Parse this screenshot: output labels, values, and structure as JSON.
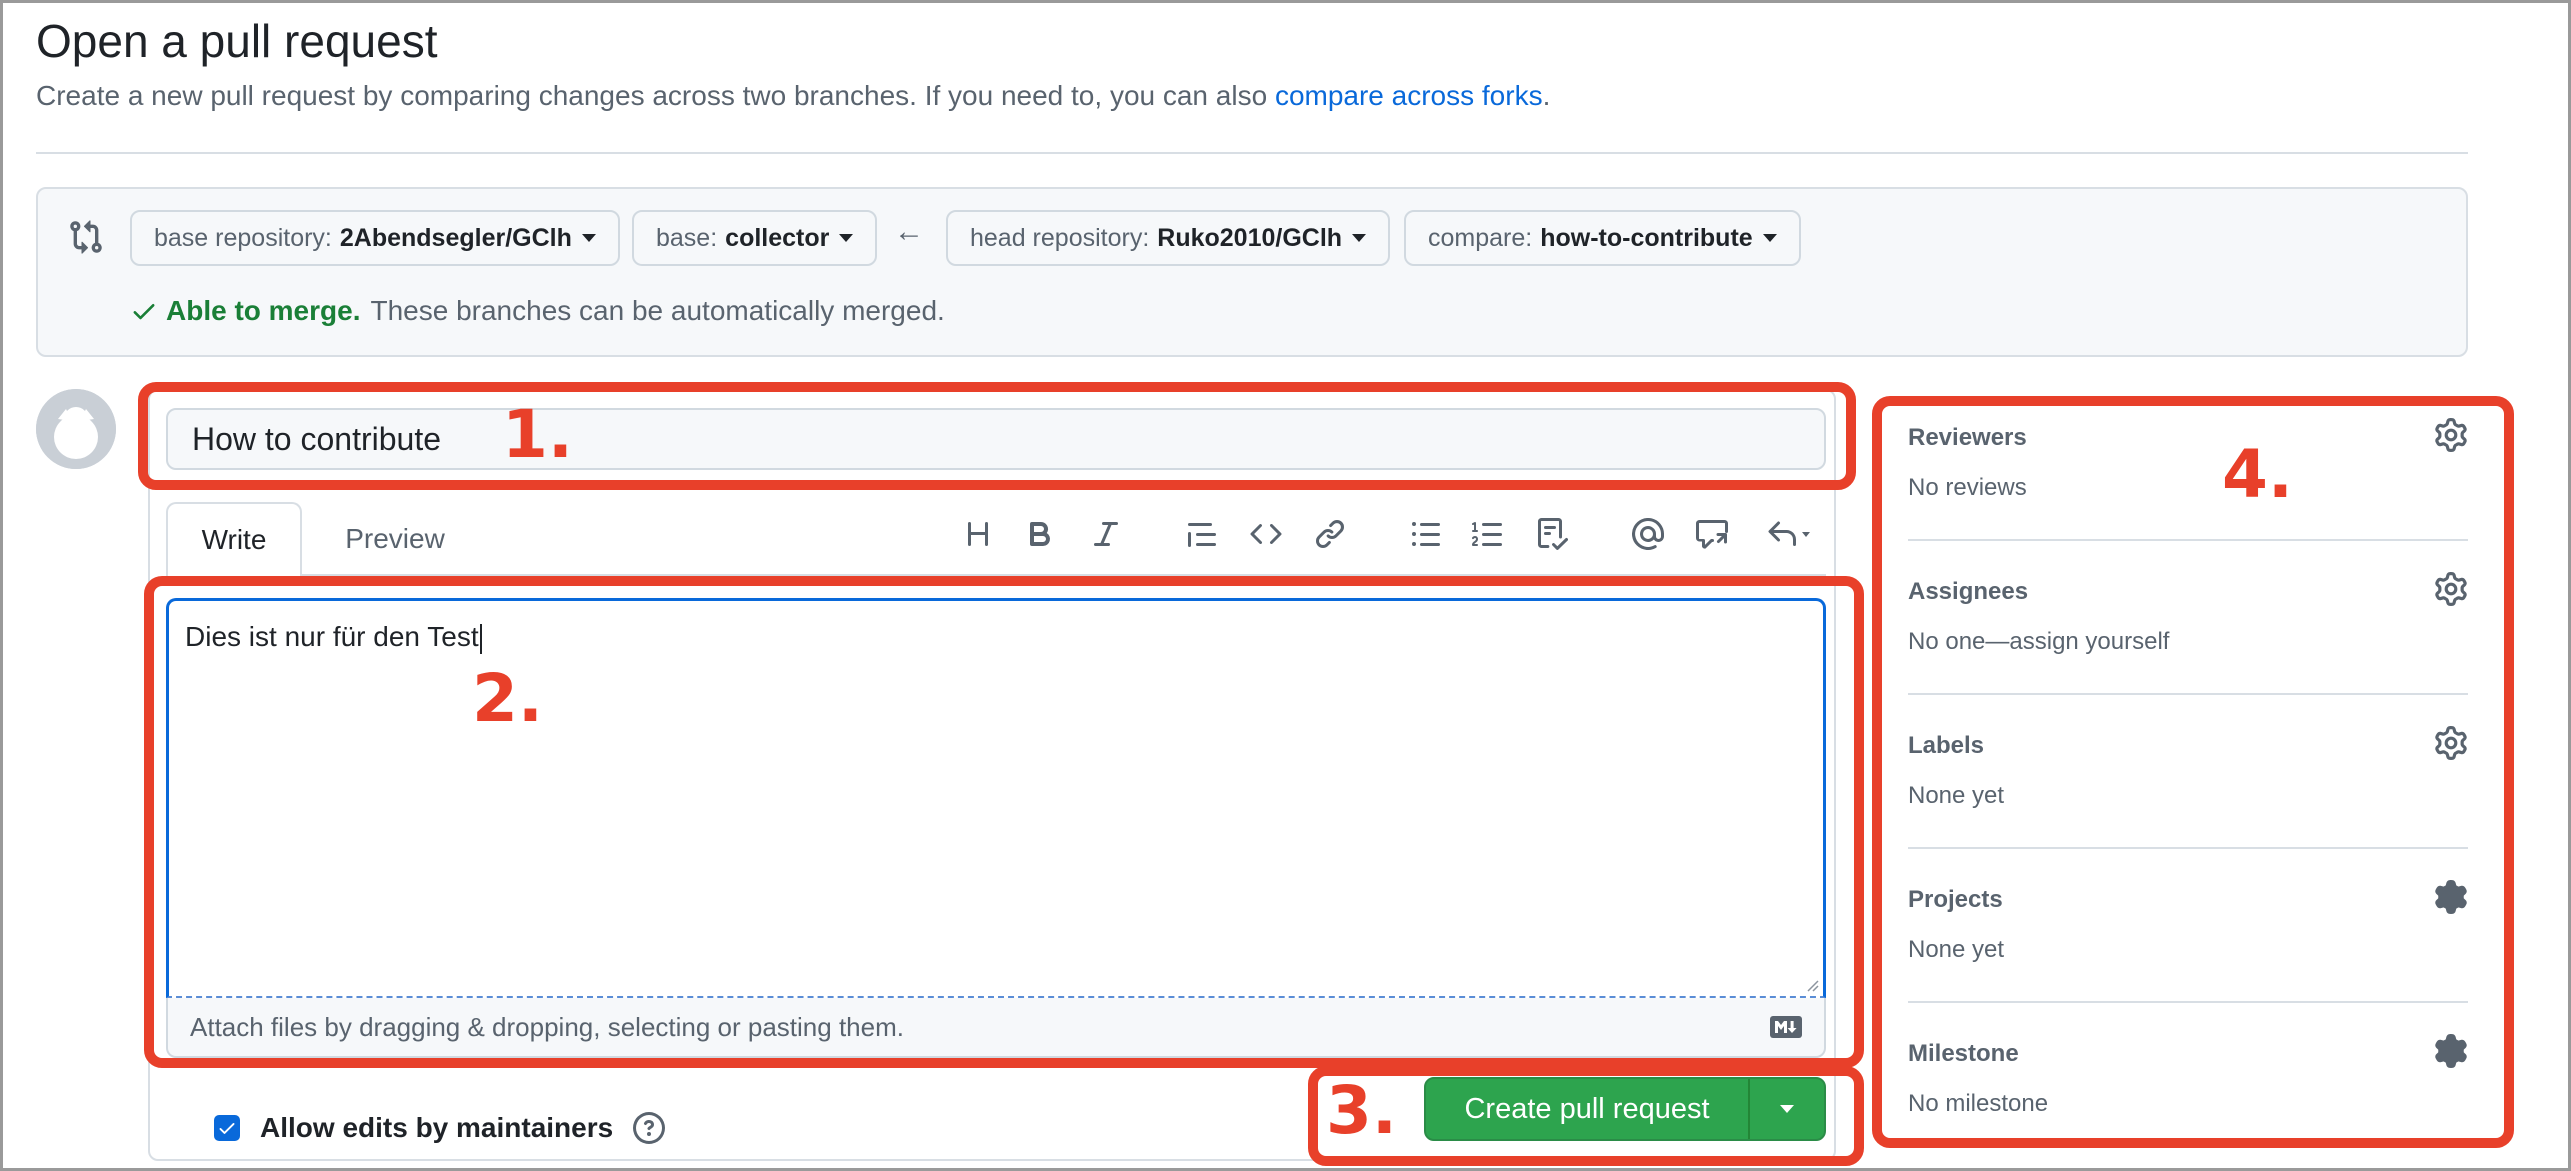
{
  "header": {
    "title": "Open a pull request",
    "subtitle_prefix": "Create a new pull request by comparing changes across two branches. If you need to, you can also",
    "subtitle_link": "compare across forks",
    "subtitle_suffix": "."
  },
  "compare": {
    "base_repository": {
      "label": "base repository:",
      "value": "2Abendsegler/GClh"
    },
    "base": {
      "label": "base:",
      "value": "collector"
    },
    "head_repository": {
      "label": "head repository:",
      "value": "Ruko2010/GClh"
    },
    "compare": {
      "label": "compare:",
      "value": "how-to-contribute"
    },
    "merge_ok": "Able to merge.",
    "merge_text": "These branches can be automatically merged."
  },
  "form": {
    "title_value": "How to contribute",
    "tabs": [
      "Write",
      "Preview"
    ],
    "body_value": "Dies ist nur für den Test",
    "attach_hint": "Attach files by dragging & dropping, selecting or pasting them.",
    "allow_edits_label": "Allow edits by maintainers",
    "allow_edits_checked": true,
    "create_label": "Create pull request"
  },
  "toolbar_icons": [
    "heading-icon",
    "bold-icon",
    "italic-icon",
    "quote-icon",
    "code-icon",
    "link-icon",
    "unordered-list-icon",
    "ordered-list-icon",
    "task-list-icon",
    "mention-icon",
    "reference-icon",
    "reply-icon"
  ],
  "sidebar": [
    {
      "heading": "Reviewers",
      "value": "No reviews"
    },
    {
      "heading": "Assignees",
      "value": "No one—assign yourself"
    },
    {
      "heading": "Labels",
      "value": "None yet"
    },
    {
      "heading": "Projects",
      "value": "None yet"
    },
    {
      "heading": "Milestone",
      "value": "No milestone"
    }
  ],
  "annotations": [
    "1.",
    "2.",
    "3.",
    "4."
  ],
  "colors": {
    "annotation": "#e8402a",
    "primary_button": "#2da44e",
    "link": "#0969da",
    "success": "#1a7f37"
  }
}
